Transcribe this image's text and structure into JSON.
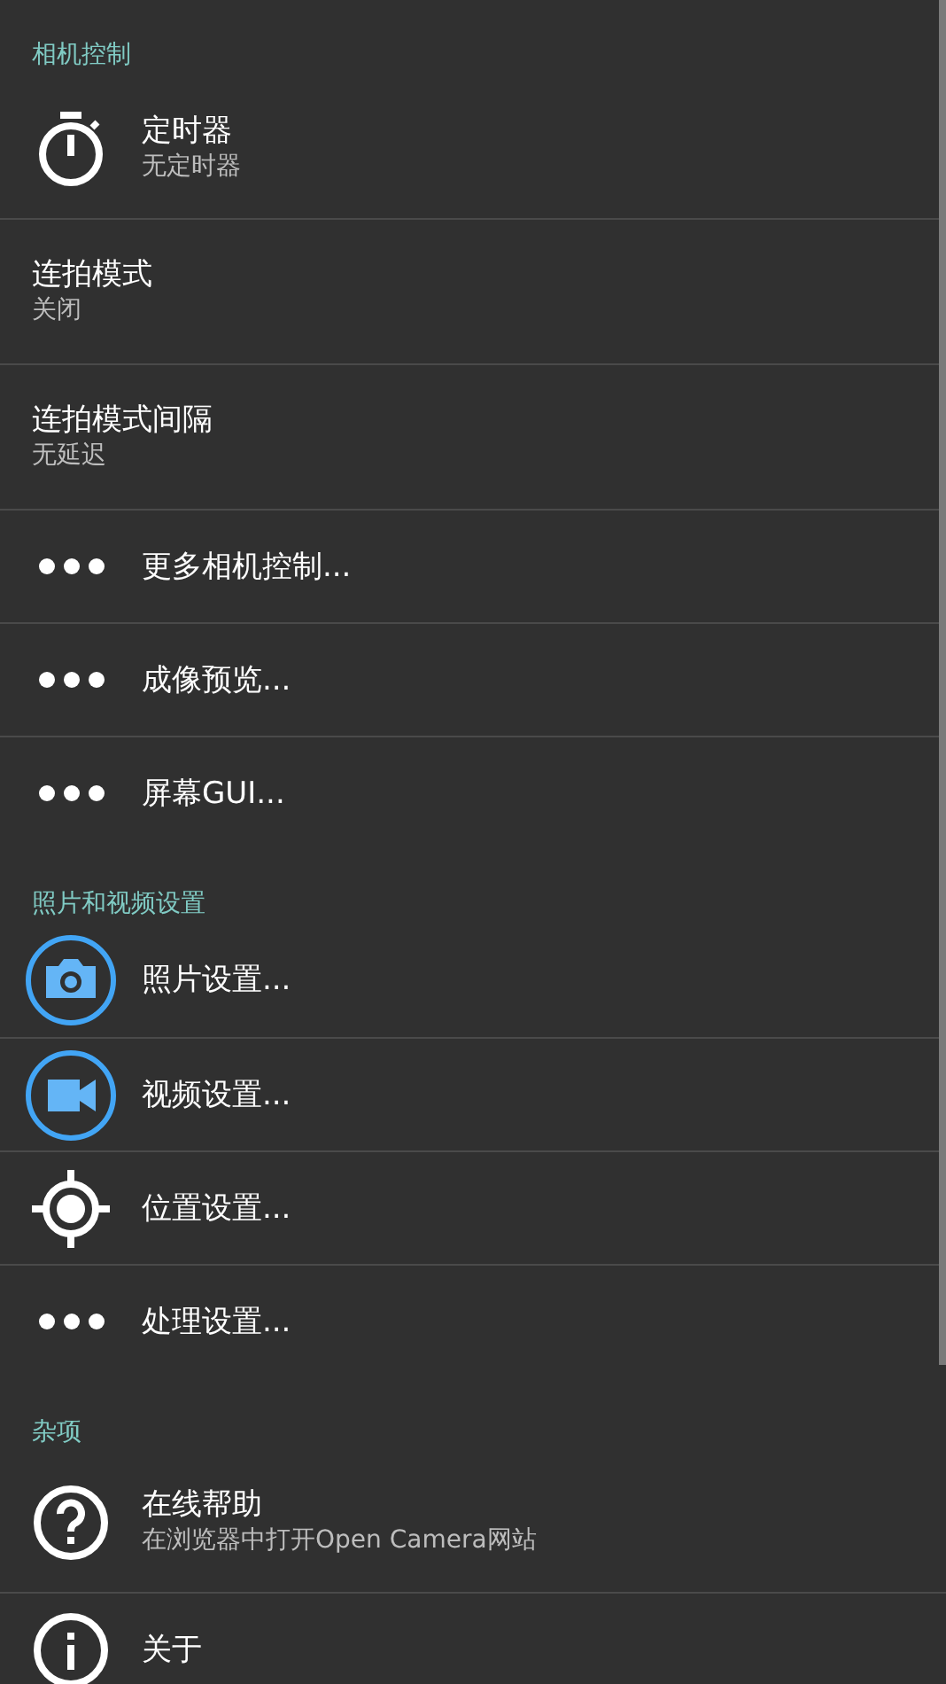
{
  "sections": [
    {
      "title": "相机控制",
      "items": [
        {
          "kind": "timer",
          "title": "定时器",
          "subtitle": "无定时器"
        },
        {
          "kind": "plain",
          "title": "连拍模式",
          "subtitle": "关闭"
        },
        {
          "kind": "plain",
          "title": "连拍模式间隔",
          "subtitle": "无延迟"
        },
        {
          "kind": "more",
          "title": "更多相机控制..."
        },
        {
          "kind": "more",
          "title": "成像预览..."
        },
        {
          "kind": "more",
          "title": "屏幕GUI..."
        }
      ]
    },
    {
      "title": "照片和视频设置",
      "items": [
        {
          "kind": "photo",
          "title": "照片设置..."
        },
        {
          "kind": "video",
          "title": "视频设置..."
        },
        {
          "kind": "location",
          "title": "位置设置..."
        },
        {
          "kind": "more",
          "title": "处理设置..."
        }
      ]
    },
    {
      "title": "杂项",
      "items": [
        {
          "kind": "help",
          "title": "在线帮助",
          "subtitle": "在浏览器中打开Open Camera网站"
        },
        {
          "kind": "about",
          "title": "关于"
        }
      ]
    }
  ]
}
